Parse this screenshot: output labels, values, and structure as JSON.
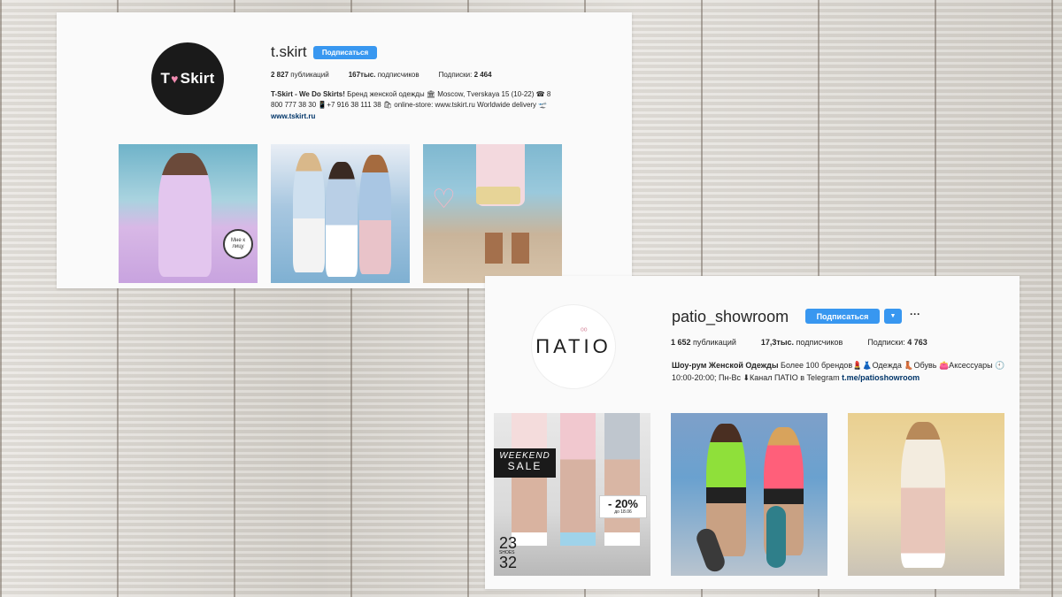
{
  "profile1": {
    "logo_text_pre": "T",
    "logo_heart": "♥",
    "logo_text_post": "Skirt",
    "username": "t.skirt",
    "follow_label": "Подписаться",
    "stats": {
      "posts_value": "2 827",
      "posts_label": "публикаций",
      "followers_value": "167тыс.",
      "followers_label": "подписчиков",
      "following_label": "Подписки:",
      "following_value": "2 464"
    },
    "bio_name": "T-Skirt - We Do Skirts!",
    "bio_text": "Бренд женской одежды 🏛 Moscow, Tverskaya 15 (10-22) ☎ 8 800 777 38 30 📱+7 916 38 111 38 🛍 online-store: www.tskirt.ru Worldwide delivery 🛫",
    "bio_link": "www.tskirt.ru",
    "posts": [
      {
        "image": "photo-woman-lilac-dress",
        "sticker_text": "Мне к лицу"
      },
      {
        "image": "photo-three-women-skirts"
      },
      {
        "image": "photo-sandals-handbag",
        "overlay_icon": "heart-outline"
      }
    ]
  },
  "profile2": {
    "logo_text": "ПАТIO",
    "logo_bow": "ᵒᵒ",
    "username": "patio_showroom",
    "follow_label": "Подписаться",
    "dropdown_icon": "caret-down-icon",
    "more_label": "···",
    "stats": {
      "posts_value": "1 652",
      "posts_label": "публикаций",
      "followers_value": "17,3тыс.",
      "followers_label": "подписчиков",
      "following_label": "Подписки:",
      "following_value": "4 763"
    },
    "bio_name": "Шоу-рум Женской Одежды",
    "bio_text": "Более 100 брендов💄👗Одежда 👢Обувь 👛Аксессуары 🕙10:00-20:00; Пн-Вс ⬇Канал ПАТIO в Telegram",
    "bio_link": "t.me/patioshowroom",
    "posts": [
      {
        "image": "photo-weekend-sale-sneakers",
        "sale_line1": "WEEKEND",
        "sale_line2": "SALE",
        "discount": "- 20%",
        "discount_date": "до 18.06",
        "corner_top": "23",
        "corner_small": "SHOES",
        "corner_bottom": "32"
      },
      {
        "image": "photo-two-girls-skateboards"
      },
      {
        "image": "photo-woman-pink-skirt"
      }
    ]
  },
  "colors": {
    "accent": "#3897f0",
    "text": "#262626",
    "link": "#003569",
    "card_bg": "#fafafa"
  }
}
